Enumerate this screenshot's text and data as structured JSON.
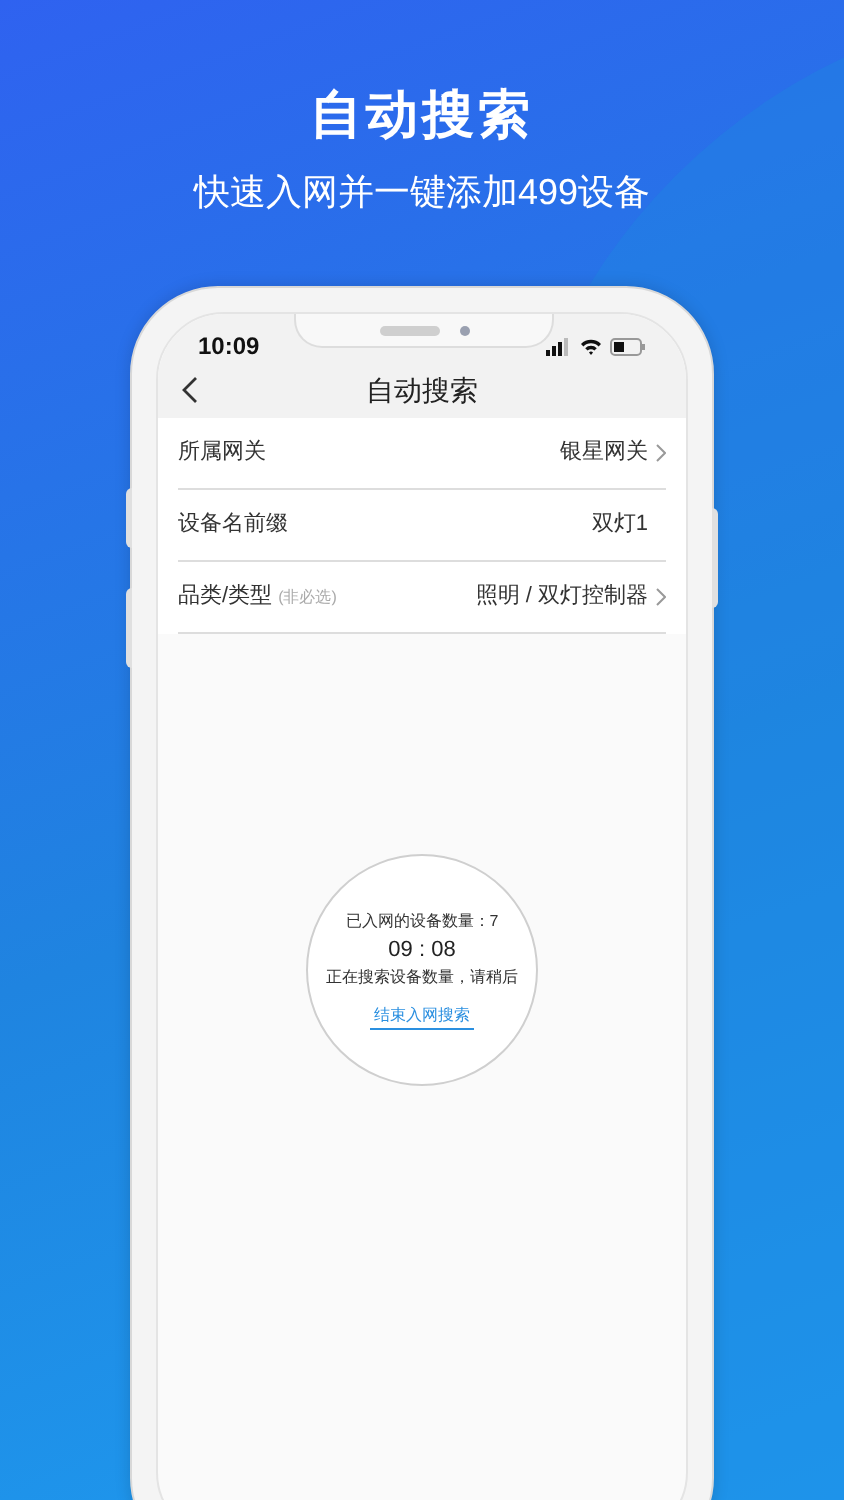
{
  "headline": {
    "title": "自动搜索",
    "subtitle": "快速入网并一键添加499设备"
  },
  "status_bar": {
    "time": "10:09"
  },
  "nav_bar": {
    "title": "自动搜索"
  },
  "rows": [
    {
      "label": "所属网关",
      "value": "银星网关",
      "has_arrow": true
    },
    {
      "label": "设备名前缀",
      "value": "双灯1",
      "has_arrow": false
    },
    {
      "label": "品类/类型",
      "hint": "(非必选)",
      "value": "照明 / 双灯控制器",
      "has_arrow": true
    }
  ],
  "search_panel": {
    "count": "已入网的设备数量：7",
    "timer": "09 : 08",
    "status": "正在搜索设备数量，请稍后",
    "end_link": "结束入网搜索"
  }
}
